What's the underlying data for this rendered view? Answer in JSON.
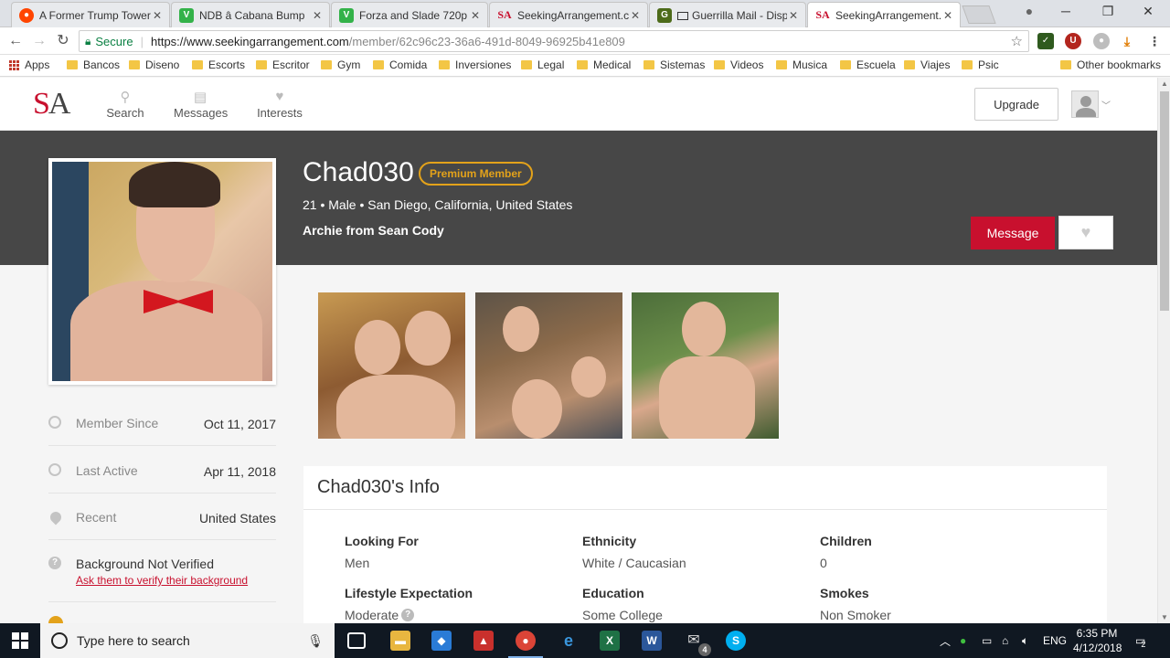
{
  "browser": {
    "tabs": [
      {
        "title": "A Former Trump Tower",
        "favicon": "reddit-icon",
        "color": "#ff4500"
      },
      {
        "title": "NDB â Cabana Bump",
        "favicon": "vine-icon",
        "color": "#33b249"
      },
      {
        "title": "Forza and Slade 720p",
        "favicon": "vine-icon",
        "color": "#33b249"
      },
      {
        "title": "SeekingArrangement.co",
        "favicon": "sa-icon",
        "color": "#c8102e"
      },
      {
        "title": "Guerrilla Mail - Disp",
        "favicon": "guerrilla-icon",
        "color": "#4d6b1a"
      },
      {
        "title": "SeekingArrangement.co",
        "favicon": "sa-icon",
        "color": "#c8102e"
      }
    ],
    "address": {
      "secure_label": "Secure",
      "url_host": "https://www.seekingarrangement.com",
      "url_path": "/member/62c96c23-36a6-491d-8049-96925b41e809"
    },
    "bookmarks": [
      "Apps",
      "Bancos",
      "Diseno",
      "Escorts",
      "Escritor",
      "Gym",
      "Comida",
      "Inversiones",
      "Legal",
      "Medical",
      "Sistemas",
      "Videos",
      "Musica",
      "Escuela",
      "Viajes",
      "Psic"
    ],
    "other_bookmarks": "Other bookmarks"
  },
  "site": {
    "logo": {
      "s": "S",
      "a": "A"
    },
    "nav": [
      {
        "label": "Search",
        "icon": "search-icon"
      },
      {
        "label": "Messages",
        "icon": "messages-icon"
      },
      {
        "label": "Interests",
        "icon": "heart-icon"
      }
    ],
    "upgrade_label": "Upgrade",
    "brand_red": "#c8102e",
    "premium_gold": "#e3a21a"
  },
  "profile": {
    "username": "Chad030",
    "badge": "Premium Member",
    "meta": "21 • Male • San Diego, California, United States",
    "tagline": "Archie from Sean Cody",
    "message_label": "Message",
    "details": [
      {
        "label": "Member Since",
        "value": "Oct 11, 2017",
        "icon": "clock-icon"
      },
      {
        "label": "Last Active",
        "value": "Apr 11, 2018",
        "icon": "clock-icon"
      },
      {
        "label": "Recent",
        "value": "United States",
        "icon": "location-pin-icon"
      },
      {
        "label": "Background Not Verified",
        "link": "Ask them to verify their background",
        "icon": "question-icon"
      }
    ],
    "info_title": "Chad030's Info",
    "info": [
      {
        "key": "Looking For",
        "value": "Men"
      },
      {
        "key": "Ethnicity",
        "value": "White / Caucasian"
      },
      {
        "key": "Children",
        "value": "0"
      },
      {
        "key": "Lifestyle Expectation",
        "value": "Moderate"
      },
      {
        "key": "Education",
        "value": "Some College"
      },
      {
        "key": "Smokes",
        "value": "Non Smoker"
      }
    ]
  },
  "taskbar": {
    "search_placeholder": "Type here to search",
    "lang": "ENG",
    "time": "6:35 PM",
    "date": "4/12/2018",
    "notifications": "2",
    "mail_count": "4"
  }
}
